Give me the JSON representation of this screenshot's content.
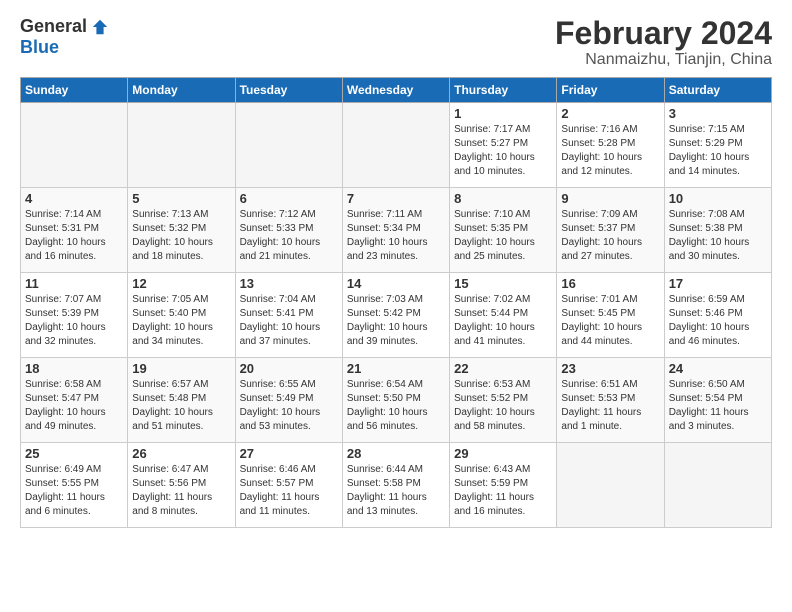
{
  "logo": {
    "general": "General",
    "blue": "Blue"
  },
  "title": "February 2024",
  "subtitle": "Nanmaizhu, Tianjin, China",
  "days_of_week": [
    "Sunday",
    "Monday",
    "Tuesday",
    "Wednesday",
    "Thursday",
    "Friday",
    "Saturday"
  ],
  "weeks": [
    [
      {
        "day": "",
        "info": ""
      },
      {
        "day": "",
        "info": ""
      },
      {
        "day": "",
        "info": ""
      },
      {
        "day": "",
        "info": ""
      },
      {
        "day": "1",
        "info": "Sunrise: 7:17 AM\nSunset: 5:27 PM\nDaylight: 10 hours\nand 10 minutes."
      },
      {
        "day": "2",
        "info": "Sunrise: 7:16 AM\nSunset: 5:28 PM\nDaylight: 10 hours\nand 12 minutes."
      },
      {
        "day": "3",
        "info": "Sunrise: 7:15 AM\nSunset: 5:29 PM\nDaylight: 10 hours\nand 14 minutes."
      }
    ],
    [
      {
        "day": "4",
        "info": "Sunrise: 7:14 AM\nSunset: 5:31 PM\nDaylight: 10 hours\nand 16 minutes."
      },
      {
        "day": "5",
        "info": "Sunrise: 7:13 AM\nSunset: 5:32 PM\nDaylight: 10 hours\nand 18 minutes."
      },
      {
        "day": "6",
        "info": "Sunrise: 7:12 AM\nSunset: 5:33 PM\nDaylight: 10 hours\nand 21 minutes."
      },
      {
        "day": "7",
        "info": "Sunrise: 7:11 AM\nSunset: 5:34 PM\nDaylight: 10 hours\nand 23 minutes."
      },
      {
        "day": "8",
        "info": "Sunrise: 7:10 AM\nSunset: 5:35 PM\nDaylight: 10 hours\nand 25 minutes."
      },
      {
        "day": "9",
        "info": "Sunrise: 7:09 AM\nSunset: 5:37 PM\nDaylight: 10 hours\nand 27 minutes."
      },
      {
        "day": "10",
        "info": "Sunrise: 7:08 AM\nSunset: 5:38 PM\nDaylight: 10 hours\nand 30 minutes."
      }
    ],
    [
      {
        "day": "11",
        "info": "Sunrise: 7:07 AM\nSunset: 5:39 PM\nDaylight: 10 hours\nand 32 minutes."
      },
      {
        "day": "12",
        "info": "Sunrise: 7:05 AM\nSunset: 5:40 PM\nDaylight: 10 hours\nand 34 minutes."
      },
      {
        "day": "13",
        "info": "Sunrise: 7:04 AM\nSunset: 5:41 PM\nDaylight: 10 hours\nand 37 minutes."
      },
      {
        "day": "14",
        "info": "Sunrise: 7:03 AM\nSunset: 5:42 PM\nDaylight: 10 hours\nand 39 minutes."
      },
      {
        "day": "15",
        "info": "Sunrise: 7:02 AM\nSunset: 5:44 PM\nDaylight: 10 hours\nand 41 minutes."
      },
      {
        "day": "16",
        "info": "Sunrise: 7:01 AM\nSunset: 5:45 PM\nDaylight: 10 hours\nand 44 minutes."
      },
      {
        "day": "17",
        "info": "Sunrise: 6:59 AM\nSunset: 5:46 PM\nDaylight: 10 hours\nand 46 minutes."
      }
    ],
    [
      {
        "day": "18",
        "info": "Sunrise: 6:58 AM\nSunset: 5:47 PM\nDaylight: 10 hours\nand 49 minutes."
      },
      {
        "day": "19",
        "info": "Sunrise: 6:57 AM\nSunset: 5:48 PM\nDaylight: 10 hours\nand 51 minutes."
      },
      {
        "day": "20",
        "info": "Sunrise: 6:55 AM\nSunset: 5:49 PM\nDaylight: 10 hours\nand 53 minutes."
      },
      {
        "day": "21",
        "info": "Sunrise: 6:54 AM\nSunset: 5:50 PM\nDaylight: 10 hours\nand 56 minutes."
      },
      {
        "day": "22",
        "info": "Sunrise: 6:53 AM\nSunset: 5:52 PM\nDaylight: 10 hours\nand 58 minutes."
      },
      {
        "day": "23",
        "info": "Sunrise: 6:51 AM\nSunset: 5:53 PM\nDaylight: 11 hours\nand 1 minute."
      },
      {
        "day": "24",
        "info": "Sunrise: 6:50 AM\nSunset: 5:54 PM\nDaylight: 11 hours\nand 3 minutes."
      }
    ],
    [
      {
        "day": "25",
        "info": "Sunrise: 6:49 AM\nSunset: 5:55 PM\nDaylight: 11 hours\nand 6 minutes."
      },
      {
        "day": "26",
        "info": "Sunrise: 6:47 AM\nSunset: 5:56 PM\nDaylight: 11 hours\nand 8 minutes."
      },
      {
        "day": "27",
        "info": "Sunrise: 6:46 AM\nSunset: 5:57 PM\nDaylight: 11 hours\nand 11 minutes."
      },
      {
        "day": "28",
        "info": "Sunrise: 6:44 AM\nSunset: 5:58 PM\nDaylight: 11 hours\nand 13 minutes."
      },
      {
        "day": "29",
        "info": "Sunrise: 6:43 AM\nSunset: 5:59 PM\nDaylight: 11 hours\nand 16 minutes."
      },
      {
        "day": "",
        "info": ""
      },
      {
        "day": "",
        "info": ""
      }
    ]
  ]
}
